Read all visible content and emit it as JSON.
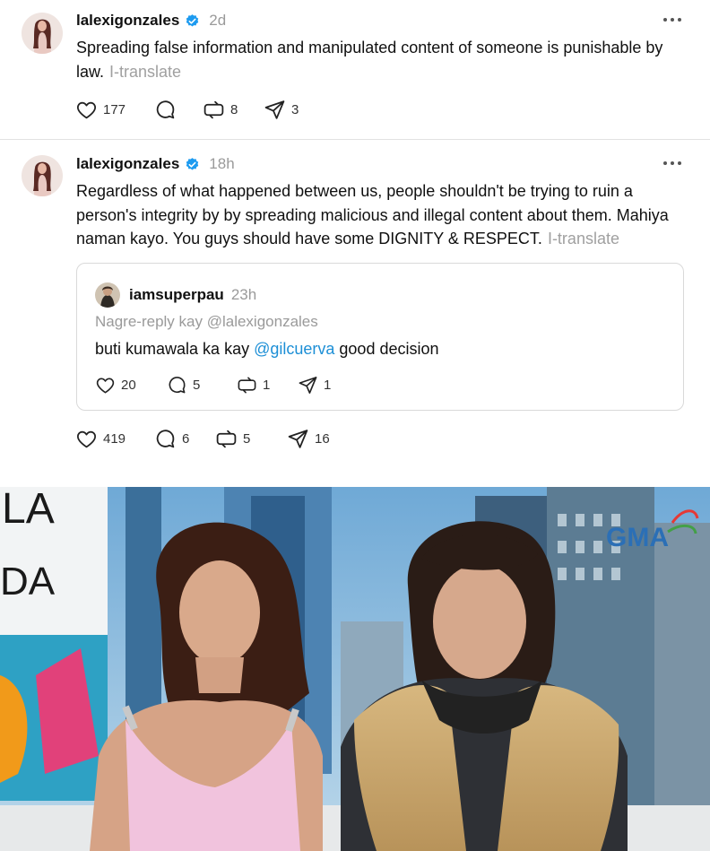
{
  "post1": {
    "username": "lalexigonzales",
    "time": "2d",
    "text": "Spreading false information and manipulated content of someone is punishable by law.",
    "translate": "I-translate",
    "likes": "177",
    "replies": "",
    "reposts": "8",
    "shares": "3"
  },
  "post2": {
    "username": "lalexigonzales",
    "time": "18h",
    "text": "Regardless of what happened between us, people shouldn't be trying to ruin a person's integrity by by spreading malicious and illegal content about them. Mahiya naman kayo. You guys should have some DIGNITY & RESPECT.",
    "translate": "I-translate",
    "likes": "419",
    "replies": "6",
    "reposts": "5",
    "shares": "16",
    "quote": {
      "username": "iamsuperpau",
      "time": "23h",
      "reply_to": "Nagre-reply kay @lalexigonzales",
      "text_before": "buti kumawala ka kay ",
      "mention": "@gilcuerva",
      "text_after": " good decision",
      "likes": "20",
      "replies": "5",
      "reposts": "1",
      "shares": "1"
    }
  },
  "photo": {
    "sign_text_1": "LA",
    "sign_text_2": "DA",
    "logo": "GMA"
  },
  "colors": {
    "verified": "#1d9bf0",
    "mention": "#1d8fd6",
    "muted": "#9a9a9a"
  },
  "icons": [
    "verified-badge-icon",
    "more-icon",
    "heart-icon",
    "reply-icon",
    "repost-icon",
    "share-icon"
  ]
}
